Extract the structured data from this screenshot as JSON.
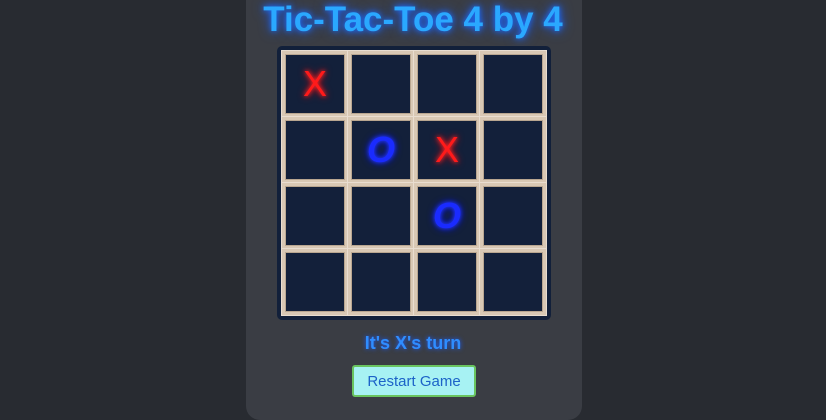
{
  "game": {
    "title": "Tic-Tac-Toe 4 by 4",
    "status": "It's X's turn",
    "restart_label": "Restart Game",
    "board": [
      [
        "X",
        "",
        "",
        ""
      ],
      [
        "",
        "O",
        "X",
        ""
      ],
      [
        "",
        "",
        "O",
        ""
      ],
      [
        "",
        "",
        "",
        ""
      ]
    ]
  },
  "colors": {
    "x_mark": "#ff1a1a",
    "o_mark": "#1a2bff",
    "title": "#2aa8ff",
    "button_bg": "#a7f2f3"
  }
}
